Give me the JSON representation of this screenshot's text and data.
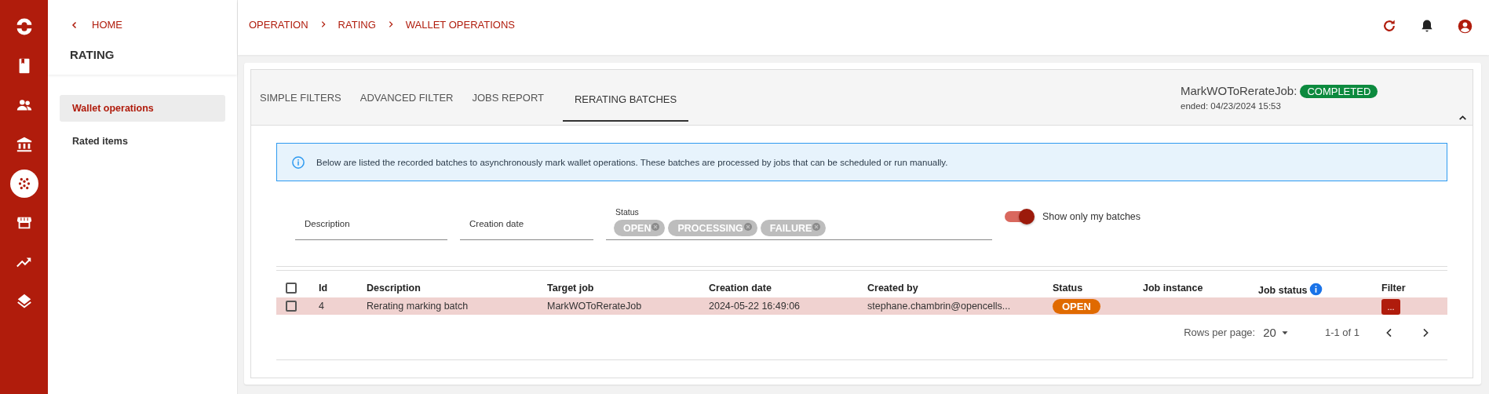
{
  "rail": {
    "items": [
      {
        "selected": false
      },
      {
        "selected": false
      },
      {
        "selected": false
      },
      {
        "selected": true
      },
      {
        "selected": false
      },
      {
        "selected": false
      },
      {
        "selected": false
      }
    ]
  },
  "sidebar": {
    "back": "HOME",
    "title": "RATING",
    "items": [
      {
        "label": "Wallet operations",
        "selected": true
      },
      {
        "label": "Rated items",
        "selected": false
      }
    ]
  },
  "breadcrumb": [
    "OPERATION",
    "RATING",
    "WALLET OPERATIONS"
  ],
  "tabs": [
    {
      "label": "SIMPLE FILTERS",
      "selected": false
    },
    {
      "label": "ADVANCED FILTER",
      "selected": false
    },
    {
      "label": "JOBS REPORT",
      "selected": false
    },
    {
      "label": "RERATING BATCHES",
      "selected": true
    }
  ],
  "job": {
    "name": "MarkWOToRerateJob:",
    "status": "COMPLETED",
    "ended": "ended: 04/23/2024 15:53"
  },
  "info": "Below are listed the recorded batches to asynchronously mark wallet operations. These batches are processed by jobs that can be scheduled or run manually.",
  "filters": {
    "description": {
      "label": "Description"
    },
    "creation_date": {
      "label": "Creation date"
    },
    "status": {
      "label": "Status",
      "chips": [
        "OPEN",
        "PROCESSING",
        "FAILURE"
      ]
    },
    "my_batches": {
      "label": "Show only my batches",
      "on": true
    }
  },
  "table": {
    "select_all": {
      "checked": false
    },
    "columns": [
      "Id",
      "Description",
      "Target job",
      "Creation date",
      "Created by",
      "Status",
      "Job instance",
      "Job status",
      "Filter"
    ],
    "rows": [
      {
        "checked": false,
        "highlighted": true,
        "id": "4",
        "description": "Rerating marking batch",
        "target_job": "MarkWOToRerateJob",
        "creation_date": "2024-05-22 16:49:06",
        "created_by": "stephane.chambrin@opencells...",
        "status": "OPEN",
        "filter": "..."
      }
    ]
  },
  "pagination": {
    "rows_label": "Rows per page:",
    "rows_value": "20",
    "range": "1-1 of 1"
  }
}
